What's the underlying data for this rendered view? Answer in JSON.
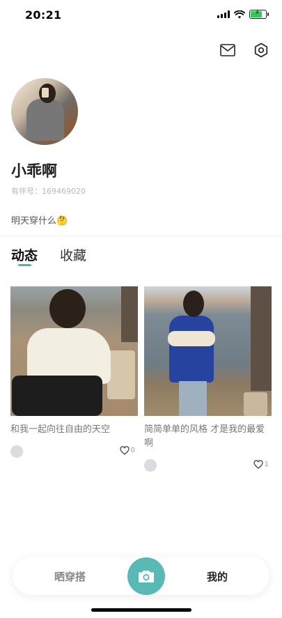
{
  "status_bar": {
    "time": "20:21"
  },
  "header": {
    "mail_icon": "mail-icon",
    "settings_icon": "settings-icon"
  },
  "profile": {
    "username": "小乖啊",
    "partner_id": "有伴号：169469020",
    "bio": "明天穿什么🤔"
  },
  "tabs": [
    {
      "label": "动态",
      "active": true
    },
    {
      "label": "收藏",
      "active": false
    }
  ],
  "posts": [
    {
      "title": "和我一起向往自由的天空",
      "likes": "0"
    },
    {
      "title": "简简单单的风格 才是我的最爱啊",
      "likes": "1"
    }
  ],
  "bottom_nav": {
    "left_label": "晒穿搭",
    "right_label": "我的",
    "camera_icon": "camera-icon",
    "accent_color": "#59b9b4"
  }
}
